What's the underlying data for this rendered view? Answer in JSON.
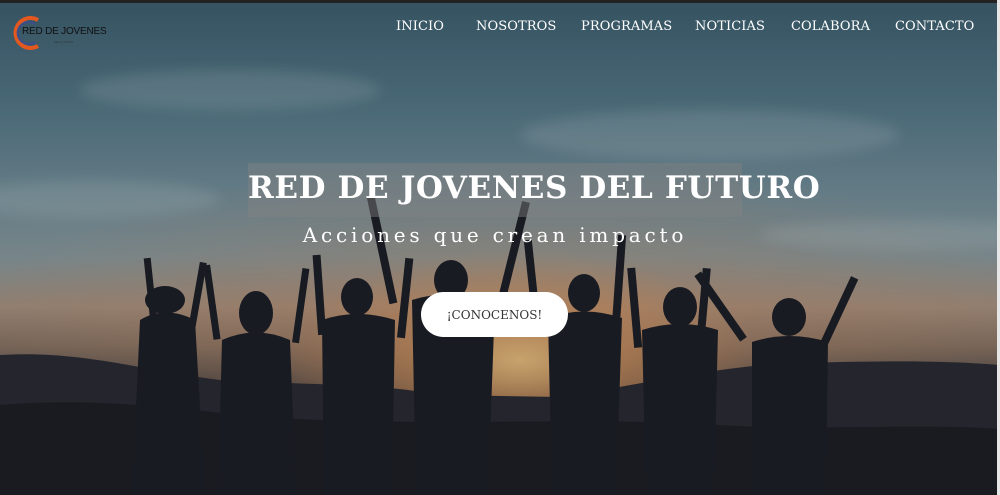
{
  "logo": {
    "text": "RED DE JOVENES",
    "tagline": "DEL FUTURO",
    "ring_color": "#e2581f"
  },
  "nav": {
    "items": [
      {
        "label": "INICIO"
      },
      {
        "label": "NOSOTROS"
      },
      {
        "label": "PROGRAMAS"
      },
      {
        "label": "NOTICIAS"
      },
      {
        "label": "COLABORA"
      },
      {
        "label": "CONTACTO"
      }
    ]
  },
  "hero": {
    "title": "RED DE JOVENES DEL FUTURO",
    "subtitle": "Acciones que crean impacto",
    "cta_label": "¡CONOCENOS!"
  },
  "colors": {
    "nav_text": "#ffffff",
    "cta_background": "#ffffff",
    "title_box": "rgba(130,130,130,0.45)"
  }
}
